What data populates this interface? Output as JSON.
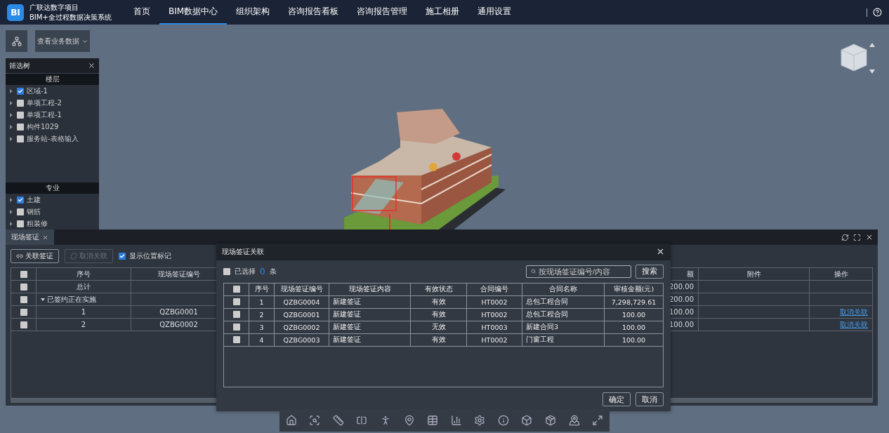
{
  "header": {
    "logo_text": "BI",
    "title": "广联达数字项目",
    "subtitle": "BIM+全过程数据决策系统",
    "nav": [
      {
        "label": "首页",
        "selected": false
      },
      {
        "label": "BIM数据中心",
        "selected": true
      },
      {
        "label": "组织架构",
        "selected": false
      },
      {
        "label": "咨询报告看板",
        "selected": false
      },
      {
        "label": "咨询报告管理",
        "selected": false
      },
      {
        "label": "施工相册",
        "selected": false
      },
      {
        "label": "通用设置",
        "selected": false
      }
    ]
  },
  "toolbar": {
    "dropdown": "查看业务数据"
  },
  "filter_tree": {
    "title": "筛选树",
    "sections": [
      {
        "heading": "楼层",
        "items": [
          {
            "label": "区域-1",
            "checked": true
          },
          {
            "label": "单项工程-2",
            "checked": false
          },
          {
            "label": "单项工程-1",
            "checked": false
          },
          {
            "label": "构件1029",
            "checked": false
          },
          {
            "label": "服务站-表格输入",
            "checked": false
          }
        ]
      },
      {
        "heading": "专业",
        "items": [
          {
            "label": "土建",
            "checked": true
          },
          {
            "label": "钢筋",
            "checked": false
          },
          {
            "label": "粗装修",
            "checked": false
          }
        ]
      }
    ]
  },
  "bottom_panel": {
    "tab": "现场签证",
    "actions": [
      {
        "label": "关联签证",
        "disabled": false
      },
      {
        "label": "取消关联",
        "disabled": true
      }
    ],
    "show_marker": {
      "label": "显示位置标记",
      "checked": true
    },
    "columns": [
      "序号",
      "现场签证编号",
      "额",
      "附件",
      "操作"
    ],
    "select_all_checked": false,
    "rows": [
      {
        "kind": "total",
        "checked": false,
        "seq": "总计",
        "amount": "200.00"
      },
      {
        "kind": "group",
        "checked": false,
        "label": "已签约正在实施",
        "expanded": true,
        "amount": "200.00"
      },
      {
        "kind": "item",
        "checked": false,
        "seq": "1",
        "code": "QZBG0001",
        "amount": "100.00",
        "action": "取消关联"
      },
      {
        "kind": "item",
        "checked": false,
        "seq": "2",
        "code": "QZBG0002",
        "amount": "100.00",
        "action": "取消关联"
      }
    ]
  },
  "modal": {
    "title": "现场签证关联",
    "selected_prefix": "已选择",
    "selected_count": "0",
    "selected_suffix": "条",
    "search_placeholder": "按现场签证编号/内容",
    "search_button": "搜索",
    "select_all_checked": false,
    "header_select_checked": false,
    "columns": [
      "序号",
      "现场签证编号",
      "现场签证内容",
      "有效状态",
      "合同编号",
      "合同名称",
      "审核金额(元)"
    ],
    "rows": [
      {
        "checked": false,
        "cells": [
          "1",
          "QZBG0004",
          "新建签证",
          "有效",
          "HT0002",
          "总包工程合同",
          "7,298,729.61"
        ]
      },
      {
        "checked": false,
        "cells": [
          "2",
          "QZBG0001",
          "新建签证",
          "有效",
          "HT0002",
          "总包工程合同",
          "100.00"
        ]
      },
      {
        "checked": false,
        "cells": [
          "3",
          "QZBG0002",
          "新建签证",
          "无效",
          "HT0003",
          "新建合同3",
          "100.00"
        ]
      },
      {
        "checked": false,
        "cells": [
          "4",
          "QZBG0003",
          "新建签证",
          "有效",
          "HT0002",
          "门窗工程",
          "100.00"
        ]
      }
    ],
    "buttons": [
      "确定",
      "取消"
    ]
  }
}
